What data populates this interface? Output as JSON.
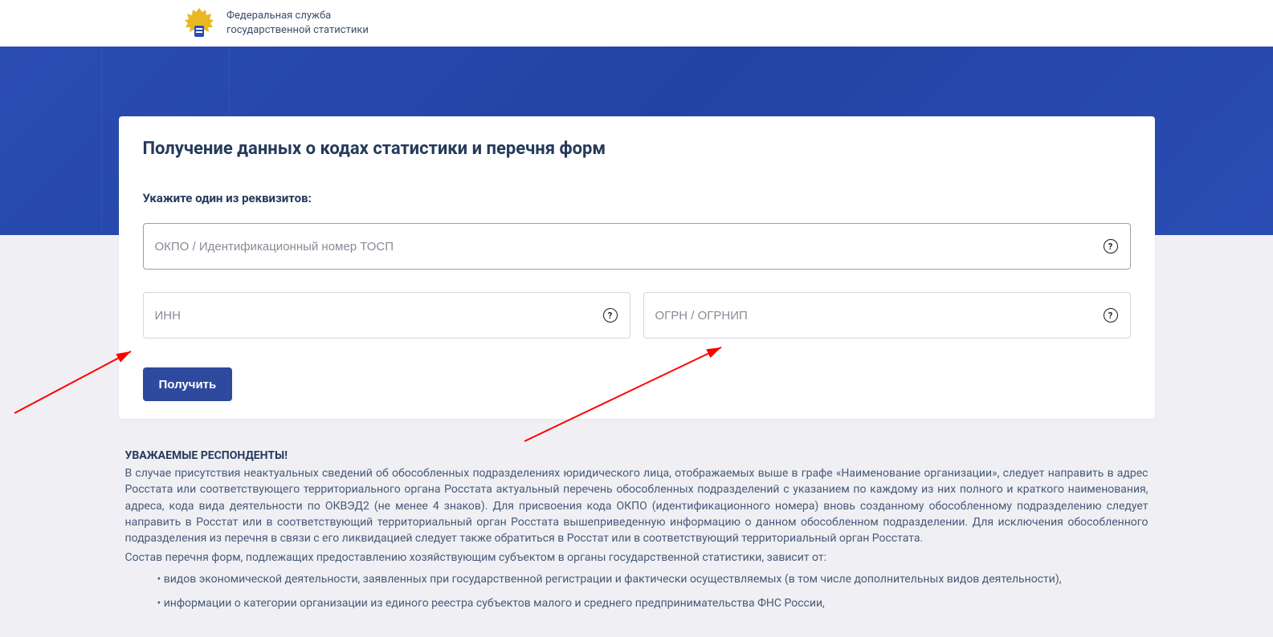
{
  "header": {
    "org_line1": "Федеральная служба",
    "org_line2": "государственной статистики"
  },
  "form": {
    "title": "Получение данных о кодах статистики и перечня форм",
    "subtitle": "Укажите один из реквизитов:",
    "field_okpo_placeholder": "ОКПО / Идентификационный номер ТОСП",
    "field_inn_placeholder": "ИНН",
    "field_ogrn_placeholder": "ОГРН / ОГРНИП",
    "submit_label": "Получить"
  },
  "notice": {
    "heading": "УВАЖАЕМЫЕ РЕСПОНДЕНТЫ!",
    "para1": "В случае присутствия неактуальных сведений об обособленных подразделениях юридического лица, отображаемых выше в графе «Наименование организации», следует направить в адрес Росстата или соответствующего территориального органа Росстата актуальный перечень обособленных подразделений с указанием по каждому из них полного и краткого наименования, адреса, кода вида деятельности по ОКВЭД2 (не менее 4 знаков). Для присвоения кода ОКПО (идентификационного номера) вновь созданному обособленному подразделению следует направить в Росстат или в соответствующий территориальный орган Росстата вышеприведенную информацию о данном обособленном подразделении. Для исключения обособленного подразделения из перечня в связи с его ликвидацией следует также обратиться в Росстат или в соответствующий территориальный орган Росстата.",
    "para2": "Состав перечня форм, подлежащих предоставлению хозяйствующим субъектом в органы государственной статистики, зависит от:",
    "bullets": [
      "видов экономической деятельности, заявленных при государственной регистрации и фактически осуществляемых (в том числе дополнительных видов деятельности),",
      "информации о категории организации из единого реестра субъектов малого и среднего предпринимательства ФНС России,"
    ]
  }
}
